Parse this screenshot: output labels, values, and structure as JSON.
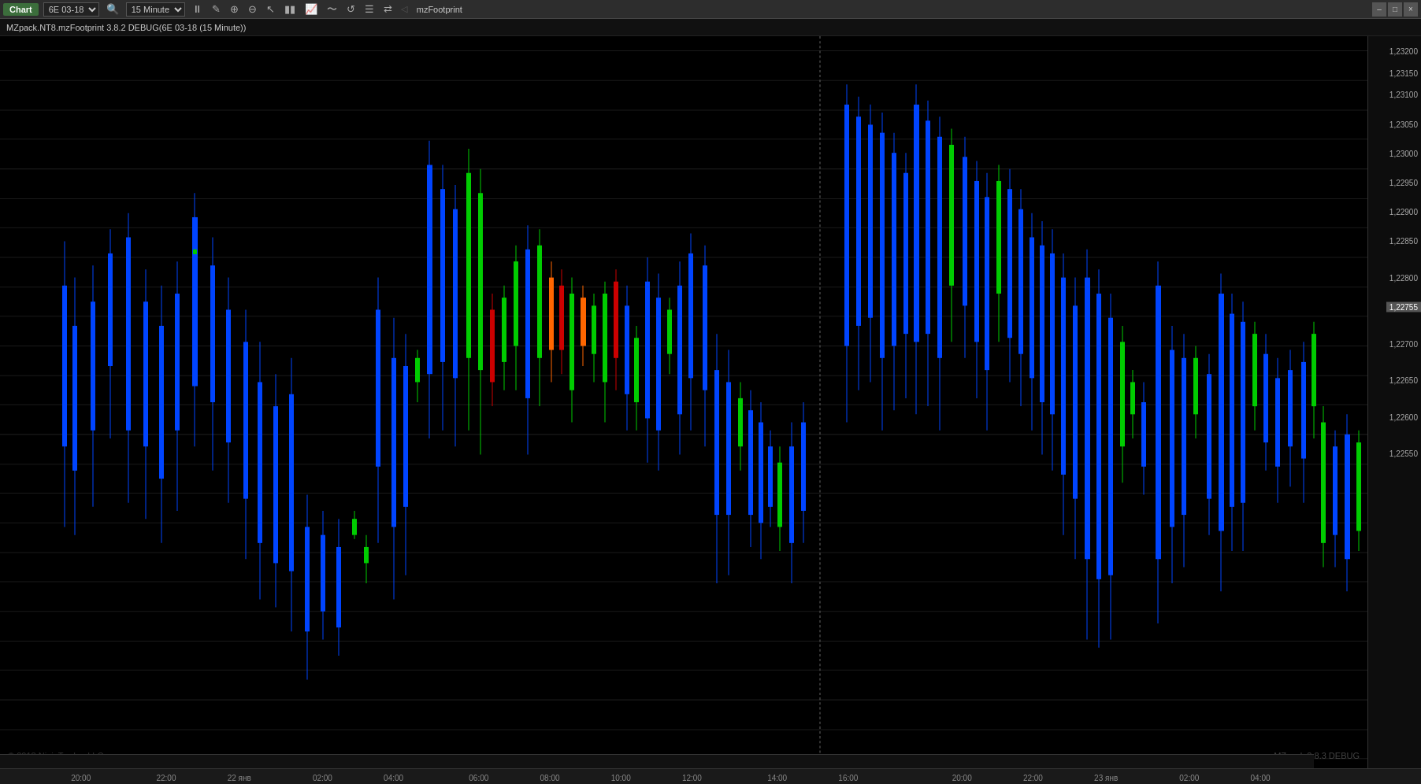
{
  "titlebar": {
    "title": "Chart",
    "instrument": "6E 03-18",
    "timeframe": "15 Minute",
    "indicator": "mzFootprint",
    "buttons": {
      "pause": "⏸",
      "pencil": "✏",
      "magnify": "🔍",
      "magnify2": "🔎",
      "cursor": "↖",
      "bars": "📊",
      "chart2": "📈",
      "wave": "〜",
      "refresh": "↺",
      "list": "☰",
      "arrows": "⇄"
    },
    "win_minimize": "–",
    "win_restore": "□",
    "win_close": "×"
  },
  "infobar": {
    "text": "MZpack.NT8.mzFootprint 3.8.2 DEBUG(6E 03-18 (15 Minute))"
  },
  "chart": {
    "price_levels": [
      {
        "price": "1,23200",
        "pct": 2
      },
      {
        "price": "1,23150",
        "pct": 5
      },
      {
        "price": "1,23100",
        "pct": 8
      },
      {
        "price": "1,23050",
        "pct": 12
      },
      {
        "price": "1,23000",
        "pct": 16
      },
      {
        "price": "1,22950",
        "pct": 20
      },
      {
        "price": "1,22900",
        "pct": 24
      },
      {
        "price": "1,22850",
        "pct": 28
      },
      {
        "price": "1,22800",
        "pct": 33
      },
      {
        "price": "1,22755",
        "pct": 37,
        "highlight": true
      },
      {
        "price": "1,22700",
        "pct": 42
      },
      {
        "price": "1,22650",
        "pct": 47
      },
      {
        "price": "1,22600",
        "pct": 52
      },
      {
        "price": "1,22550",
        "pct": 57
      }
    ],
    "time_labels": [
      {
        "label": "20:00",
        "pct": 5
      },
      {
        "label": "22:00",
        "pct": 11
      },
      {
        "label": "22 янв",
        "pct": 16
      },
      {
        "label": "02:00",
        "pct": 22
      },
      {
        "label": "04:00",
        "pct": 27
      },
      {
        "label": "06:00",
        "pct": 33
      },
      {
        "label": "08:00",
        "pct": 38
      },
      {
        "label": "10:00",
        "pct": 43
      },
      {
        "label": "12:00",
        "pct": 48
      },
      {
        "label": "14:00",
        "pct": 54
      },
      {
        "label": "16:00",
        "pct": 59
      },
      {
        "label": "20:00",
        "pct": 67
      },
      {
        "label": "22:00",
        "pct": 72
      },
      {
        "label": "23 янв",
        "pct": 77
      },
      {
        "label": "02:00",
        "pct": 83
      },
      {
        "label": "04:00",
        "pct": 88
      }
    ],
    "divider_pct": 60,
    "watermark_left": "© 2018 NinjaTrader, LLC",
    "watermark_right": "MZpack 3.8.3 DEBUG"
  },
  "statusbar": {
    "text": ""
  }
}
